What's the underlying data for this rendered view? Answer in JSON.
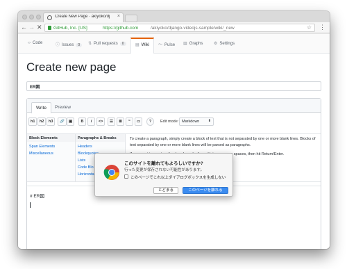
{
  "browser": {
    "tab": {
      "title": "Create New Page · akiyoko/dj",
      "close": "×"
    },
    "nav": {
      "back": "←",
      "forward": "→",
      "stop": "✕",
      "menu": "⋮",
      "star": "☆"
    },
    "address": {
      "ev_org": "GitHub, Inc. [US]",
      "host": "https://github.com",
      "path": "/akiyoko/django-videojs-sample/wiki/_new"
    }
  },
  "repo_nav": {
    "code": "Code",
    "issues": "Issues",
    "issues_count": "0",
    "pull_requests": "Pull requests",
    "pull_requests_count": "0",
    "wiki": "Wiki",
    "pulse": "Pulse",
    "graphs": "Graphs",
    "settings": "Settings",
    "icons": {
      "code": "‹›",
      "issues": "ⓘ",
      "pull_requests": "⇅",
      "wiki": "▤",
      "pulse": "〜",
      "graphs": "▥",
      "settings": "⚙"
    }
  },
  "page": {
    "title": "Create new page",
    "page_title_value": "ER図"
  },
  "editor": {
    "tabs": {
      "write": "Write",
      "preview": "Preview"
    },
    "toolbar": {
      "h1": "h1",
      "h2": "h2",
      "h3": "h3",
      "link": "🔗",
      "image": "▣",
      "bold": "B",
      "italic": "i",
      "code": "<>",
      "ul": "☰",
      "ol": "≣",
      "quote": "“",
      "hr": "▭",
      "help": "?",
      "edit_mode_label": "Edit mode:",
      "edit_mode_value": "Markdown",
      "caret": "⬍"
    },
    "cheatsheet": {
      "col1_header": "Block Elements",
      "col1_items": [
        "Span Elements",
        "Miscellaneous"
      ],
      "col2_header": "Paragraphs & Breaks",
      "col2_items": [
        "Headers",
        "Blockquotes",
        "Lists",
        "Code Blo",
        "Horizonta"
      ],
      "text1": "To create a paragraph, simply create a block of text that is not separated by one or more blank lines. Blocks of text separated by one or more blank lines will be parsed as paragraphs.",
      "text2": "If you want to create a line break, end a line with two or more spaces, then hit Return/Enter."
    },
    "body_text": "# ER図"
  },
  "dialog": {
    "title": "このサイトを離れてもよろしいですか?",
    "message": "行った変更が保存されない可能性があります。",
    "checkbox_label": "このページでこれ以上ダイアログボックスを生成しない",
    "stay_button": "とどまる",
    "leave_button": "このページを離れる"
  },
  "colors": {
    "accent_orange": "#e36209",
    "link_blue": "#0366d6",
    "secure_green": "#2e9b37",
    "dialog_primary": "#3b8cf0"
  }
}
